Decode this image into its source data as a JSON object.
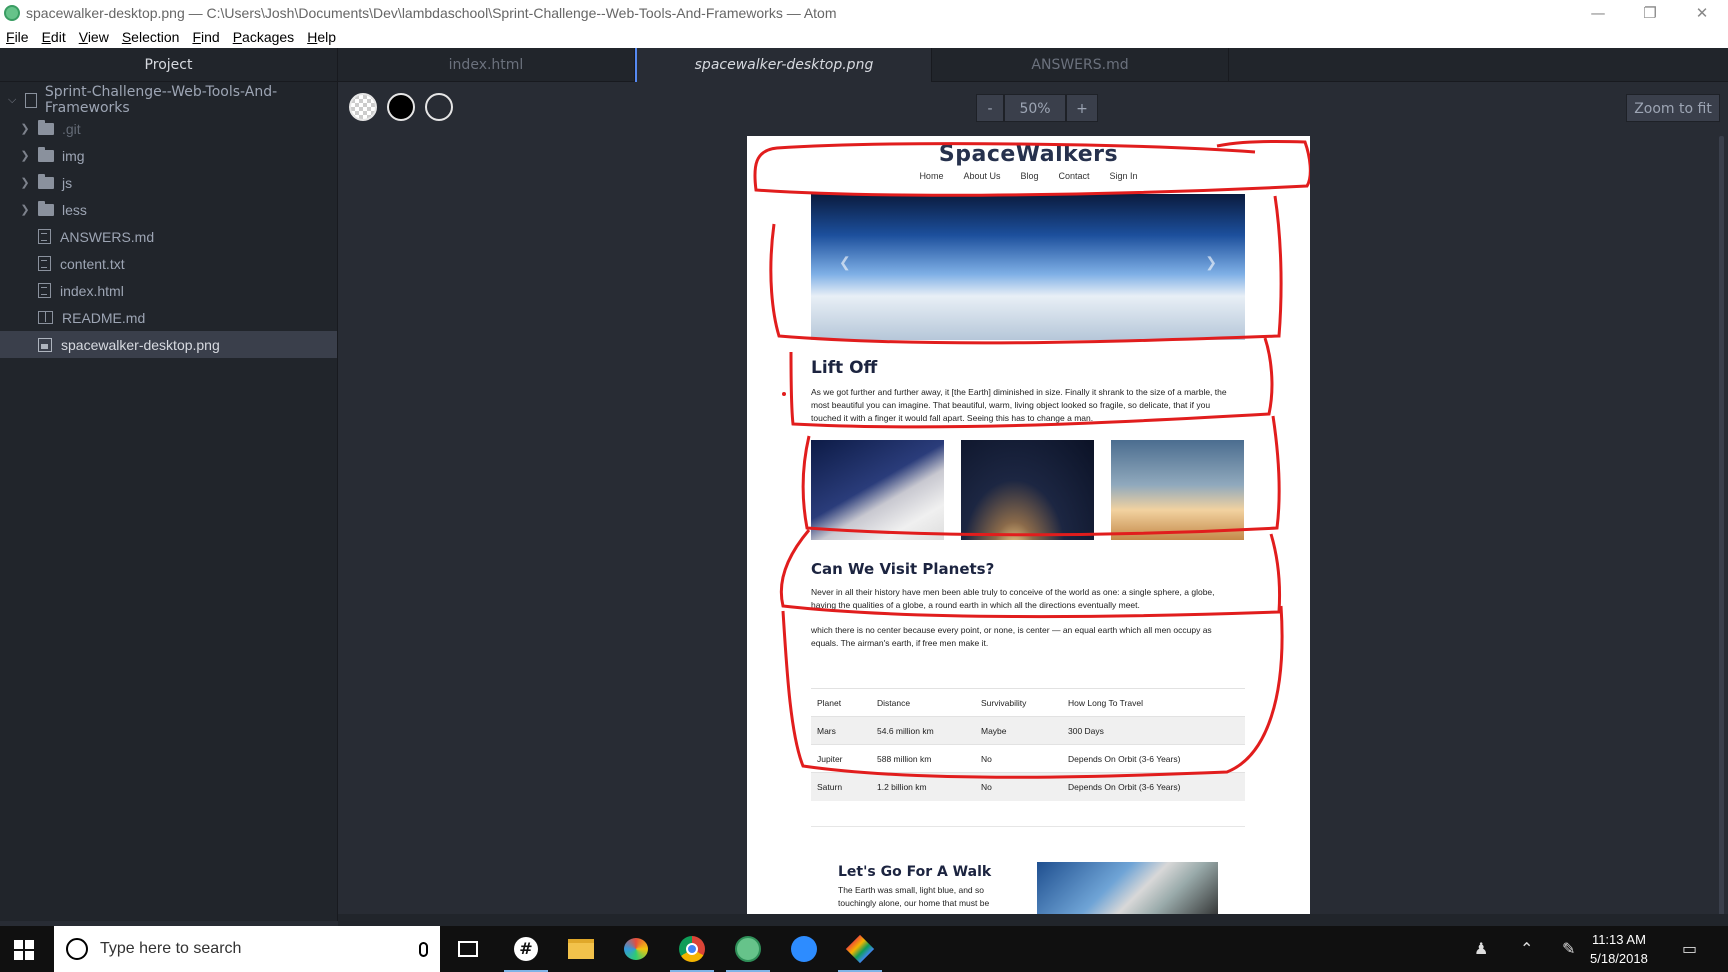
{
  "window": {
    "title": "spacewalker-desktop.png — C:\\Users\\Josh\\Documents\\Dev\\lambdaschool\\Sprint-Challenge--Web-Tools-And-Frameworks — Atom",
    "minimize": "—",
    "restore": "❐",
    "close": "✕"
  },
  "menu": [
    "File",
    "Edit",
    "View",
    "Selection",
    "Find",
    "Packages",
    "Help"
  ],
  "sidebar": {
    "panel_title": "Project",
    "root": "Sprint-Challenge--Web-Tools-And-Frameworks",
    "items": [
      {
        "label": ".git",
        "type": "folder"
      },
      {
        "label": "img",
        "type": "folder"
      },
      {
        "label": "js",
        "type": "folder"
      },
      {
        "label": "less",
        "type": "folder"
      },
      {
        "label": "ANSWERS.md",
        "type": "file"
      },
      {
        "label": "content.txt",
        "type": "file"
      },
      {
        "label": "index.html",
        "type": "file"
      },
      {
        "label": "README.md",
        "type": "book"
      },
      {
        "label": "spacewalker-desktop.png",
        "type": "image",
        "selected": true
      }
    ]
  },
  "tabs": [
    {
      "label": "index.html",
      "active": false
    },
    {
      "label": "spacewalker-desktop.png",
      "active": true
    },
    {
      "label": "ANSWERS.md",
      "active": false
    }
  ],
  "viewer": {
    "zoom_minus": "-",
    "zoom_level": "50%",
    "zoom_plus": "+",
    "zoom_to_fit": "Zoom to fit"
  },
  "mockup": {
    "logo": "SpaceWalkers",
    "nav": [
      "Home",
      "About Us",
      "Blog",
      "Contact",
      "Sign In"
    ],
    "section1_title": "Lift Off",
    "section1_text": "As we got further and further away, it [the Earth] diminished in size. Finally it shrank to the size of a marble, the most beautiful you can imagine. That beautiful, warm, living object looked so fragile, so delicate, that if you touched it with a finger it would fall apart. Seeing this has to change a man.",
    "section2_title": "Can We Visit Planets?",
    "section2_text1": "Never in all their history have men been able truly to conceive of the world as one: a single sphere, a globe, having the qualities of a globe, a round earth in which all the directions eventually meet.",
    "section2_text2": "which there is no center because every point, or none, is center — an equal earth which all men occupy as equals. The airman's earth, if free men make it.",
    "table": {
      "headers": [
        "Planet",
        "Distance",
        "Survivability",
        "How Long To Travel"
      ],
      "rows": [
        [
          "Mars",
          "54.6 million km",
          "Maybe",
          "300 Days"
        ],
        [
          "Jupiter",
          "588 million km",
          "No",
          "Depends On Orbit (3-6 Years)"
        ],
        [
          "Saturn",
          "1.2 billion km",
          "No",
          "Depends On Orbit (3-6 Years)"
        ]
      ]
    },
    "section3_title": "Let's Go For A Walk",
    "section3_text": "The Earth was small, light blue, and so touchingly alone, our home that must be"
  },
  "taskbar": {
    "search_placeholder": "Type here to search",
    "time": "11:13 AM",
    "date": "5/18/2018"
  },
  "colors": {
    "annotation": "#e11d1d",
    "accent": "#568af2"
  }
}
